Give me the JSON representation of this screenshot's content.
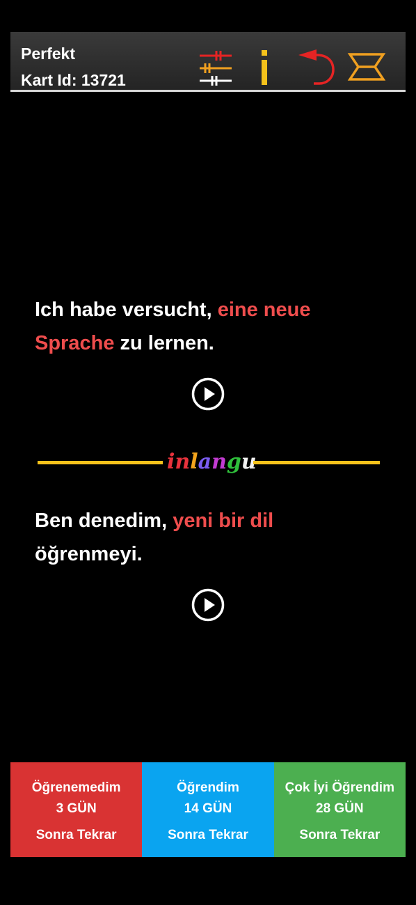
{
  "header": {
    "title": "Perfekt",
    "card_id": "Kart Id: 13721"
  },
  "front": {
    "part1": "Ich habe versucht, ",
    "highlight1": "eine neue",
    "highlight2": "Sprache",
    "part2": " zu lernen."
  },
  "divider": {
    "logo_letters": [
      "i",
      "n",
      "l",
      "a",
      "n",
      "g",
      "u"
    ],
    "logo_colors": [
      "#e8323c",
      "#e8323c",
      "#f3a41c",
      "#7a5cf0",
      "#c23bd1",
      "#2fbf3b",
      "#f2f2f2"
    ]
  },
  "back": {
    "part1": "Ben denedim, ",
    "highlight1": "yeni bir dil",
    "line2": "öğrenmeyi."
  },
  "answers": [
    {
      "label": "Öğrenemedim",
      "days": "3 GÜN",
      "sub": "Sonra Tekrar",
      "color": "#d93333"
    },
    {
      "label": "Öğrendim",
      "days": "14 GÜN",
      "sub": "Sonra Tekrar",
      "color": "#0aa4f0"
    },
    {
      "label": "Çok İyi Öğrendim",
      "days": "28 GÜN",
      "sub": "Sonra Tekrar",
      "color": "#4caf50"
    }
  ],
  "colors": {
    "highlight": "#ef4d4d",
    "divider": "#f5c21b",
    "info_icon": "#f5c21b",
    "undo_icon": "#e52424",
    "swap_icon": "#f0a020"
  }
}
